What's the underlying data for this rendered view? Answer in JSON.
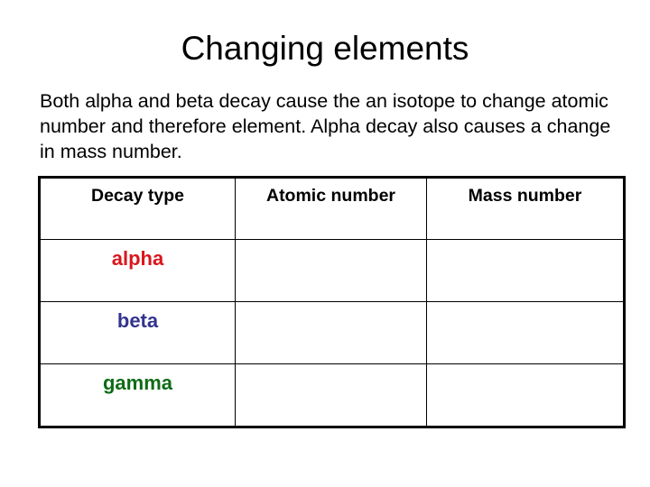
{
  "slide": {
    "title": "Changing elements",
    "intro": "Both alpha and beta decay cause the an isotope to change atomic number and therefore element. Alpha decay also causes a change in mass number."
  },
  "table": {
    "headers": [
      "Decay type",
      "Atomic number",
      "Mass number"
    ],
    "rows": [
      {
        "decay_type": "alpha",
        "color": "#d9161c",
        "atomic_number": "",
        "mass_number": ""
      },
      {
        "decay_type": "beta",
        "color": "#33338f",
        "atomic_number": "",
        "mass_number": ""
      },
      {
        "decay_type": "gamma",
        "color": "#0f6b16",
        "atomic_number": "",
        "mass_number": ""
      }
    ]
  }
}
